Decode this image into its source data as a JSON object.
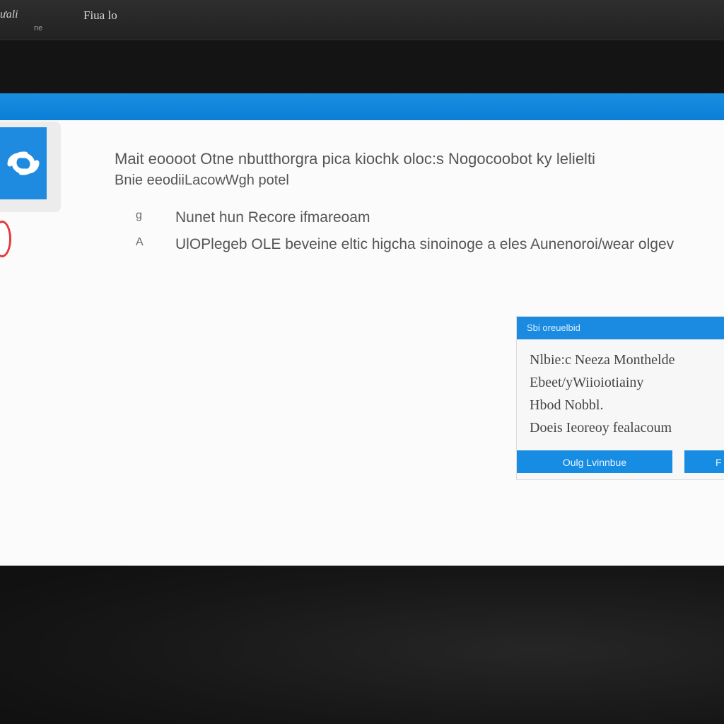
{
  "titlebar": {
    "app_label": "ưali",
    "app_sublabel": "ne",
    "window_title": "Fiua lo"
  },
  "dialog": {
    "heading_line1": "Mait eoooot Otne nbutthorgra pica kiochk oloc:s Nogocoobot ky lelielti",
    "heading_line2": "Bnie eeodiiLacowWgh potel",
    "bullets": [
      {
        "symbol": "g",
        "text": "Nunet hun Recore ifmareoam"
      },
      {
        "symbol": "A",
        "text": "UlOPlegeb OLE beveine eltic higcha sinoinoge a eles Aunenoroi/wear olgev"
      }
    ]
  },
  "info_panel": {
    "header": "Sbi oreuelbid",
    "items": [
      "Nlbie:c Neeza Monthelde",
      "Ebeet/yWiioiotiainy",
      "Hbod Nobbl.",
      "Doeis Ieoreoy fealacoum"
    ],
    "primary_button": "Oulg Lvinnbue",
    "secondary_button": "F"
  },
  "colors": {
    "accent": "#0b7fd6",
    "button": "#168ce2",
    "dialog_bg": "#fbfbfb",
    "desktop_bg": "#141414",
    "error": "#e23b3b"
  },
  "icons": {
    "app_logo": "chain-link-icon",
    "error_badge": "error-icon"
  }
}
